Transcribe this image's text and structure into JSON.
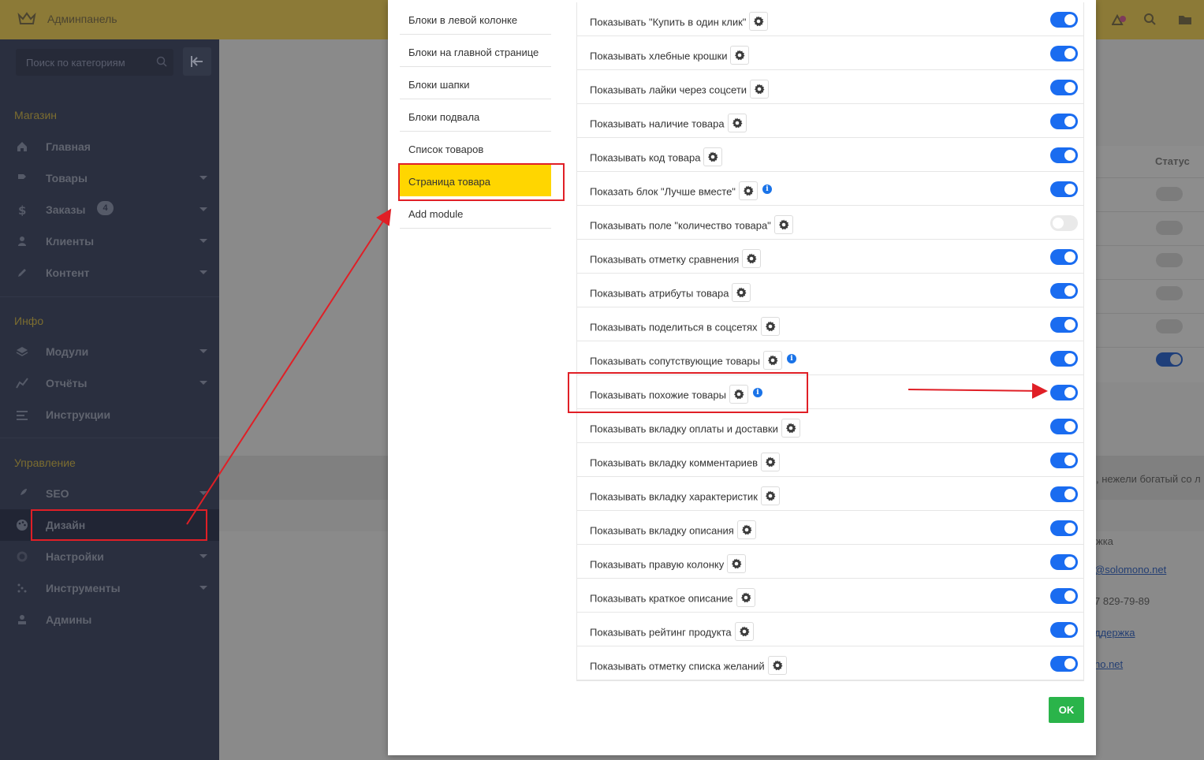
{
  "topbar": {
    "brand": "Админпанель"
  },
  "sidebar": {
    "search_placeholder": "Поиск по категориям",
    "sections": [
      {
        "title": "Магазин"
      },
      {
        "title": "Инфо"
      },
      {
        "title": "Управление"
      }
    ],
    "items": [
      {
        "label": "Главная",
        "icon": "home-icon"
      },
      {
        "label": "Товары",
        "icon": "tag-icon"
      },
      {
        "label": "Заказы",
        "icon": "dollar-icon",
        "badge": "4"
      },
      {
        "label": "Клиенты",
        "icon": "user-icon"
      },
      {
        "label": "Контент",
        "icon": "pencil-icon"
      },
      {
        "label": "Модули",
        "icon": "layers-icon"
      },
      {
        "label": "Отчёты",
        "icon": "chart-line-icon"
      },
      {
        "label": "Инструкции",
        "icon": "list-icon"
      },
      {
        "label": "SEO",
        "icon": "rocket-icon"
      },
      {
        "label": "Дизайн",
        "icon": "palette-icon"
      },
      {
        "label": "Настройки",
        "icon": "gear-icon"
      },
      {
        "label": "Инструменты",
        "icon": "tools-icon"
      },
      {
        "label": "Админы",
        "icon": "admin-icon"
      }
    ]
  },
  "background": {
    "status_header": "Статус",
    "band_text": ", нежели богатый со л",
    "col_header": "жка",
    "email": "@solomono.net",
    "phone": "7 829-79-89",
    "support": "ддержка",
    "site": "no.net"
  },
  "modal": {
    "nav": [
      {
        "label": "Блоки в левой колонке"
      },
      {
        "label": "Блоки на главной странице"
      },
      {
        "label": "Блоки шапки"
      },
      {
        "label": "Блоки подвала"
      },
      {
        "label": "Список товаров"
      },
      {
        "label": "Страница товара"
      },
      {
        "label": "Add module"
      }
    ],
    "settings": [
      {
        "label": "Показывать \"Купить в один клик\""
      },
      {
        "label": "Показывать хлебные крошки"
      },
      {
        "label": "Показывать лайки через соцсети"
      },
      {
        "label": "Показывать наличие товара"
      },
      {
        "label": "Показывать код товара"
      },
      {
        "label": "Показать блок \"Лучше вместе\""
      },
      {
        "label": "Показывать поле \"количество товара\""
      },
      {
        "label": "Показывать отметку сравнения"
      },
      {
        "label": "Показывать атрибуты товара"
      },
      {
        "label": "Показывать поделиться в соцсетях"
      },
      {
        "label": "Показывать сопутствующие товары"
      },
      {
        "label": "Показывать похожие товары"
      },
      {
        "label": "Показывать вкладку оплаты и доставки"
      },
      {
        "label": "Показывать вкладку комментариев"
      },
      {
        "label": "Показывать вкладку характеристик"
      },
      {
        "label": "Показывать вкладку описания"
      },
      {
        "label": "Показывать правую колонку"
      },
      {
        "label": "Показывать краткое описание"
      },
      {
        "label": "Показывать рейтинг продукта"
      },
      {
        "label": "Показывать отметку списка желаний"
      }
    ],
    "ok_label": "OK"
  },
  "colors": {
    "toggle_on": "#1a6cf0",
    "active_nav": "#ffd600",
    "annotation": "#e01f26",
    "ok": "#2ab44a",
    "info": "#1a73e8"
  }
}
